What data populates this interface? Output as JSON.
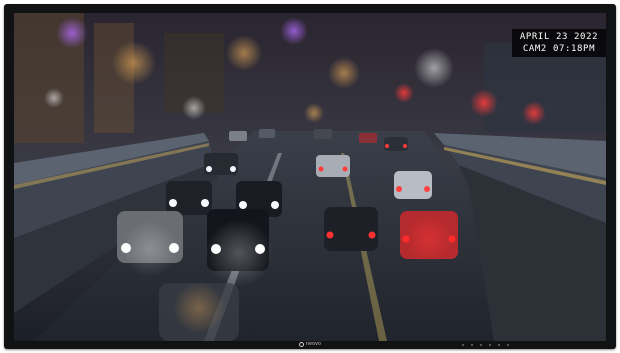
{
  "overlay": {
    "date": "APRIL 23 2022",
    "camera_time": "CAM2  07:18PM"
  },
  "bezel": {
    "brand": "neovo",
    "button_count": 6
  },
  "colors": {
    "bezel": "#111214",
    "overlay_background": "#000000",
    "overlay_text": "#ffffff"
  }
}
